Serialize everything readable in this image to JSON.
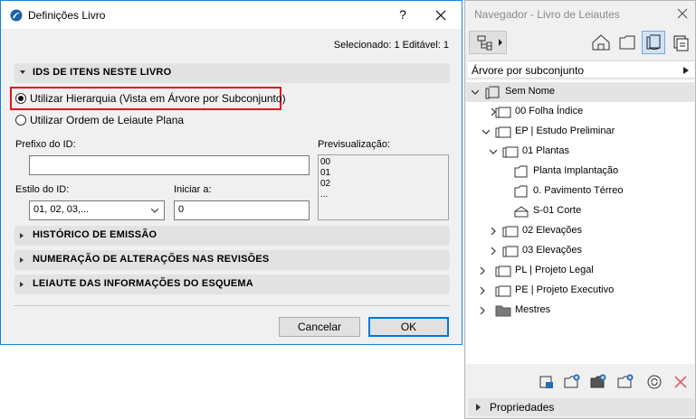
{
  "dialog": {
    "title": "Definições Livro",
    "help_label": "?",
    "selected_info": "Selecionado: 1 Editável: 1",
    "sections": {
      "ids": "IDS DE ITENS NESTE LIVRO",
      "history": "HISTÓRICO DE EMISSÃO",
      "numbering": "NUMERAÇÃO DE ALTERAÇÕES NAS REVISÕES",
      "layout_info": "LEIAUTE DAS INFORMAÇÕES DO ESQUEMA"
    },
    "radio_hierarchy": "Utilizar Hierarquia (Vista em Árvore por Subconjunto)",
    "radio_flat": "Utilizar Ordem de Leiaute Plana",
    "prefix_label": "Prefixo do ID:",
    "prefix_value": "",
    "preview_label": "Previsualização:",
    "preview_lines": [
      "00",
      "01",
      "02",
      "..."
    ],
    "style_label": "Estilo do ID:",
    "style_value": "01, 02, 03,...",
    "start_label": "Iniciar a:",
    "start_value": "0",
    "cancel_label": "Cancelar",
    "ok_label": "OK"
  },
  "navigator": {
    "title": "Navegador - Livro de Leiautes",
    "dropdown_label": "Árvore por subconjunto",
    "tree": [
      {
        "label": "Sem Nome"
      },
      {
        "label": "00 Folha Índice"
      },
      {
        "label": "EP | Estudo Preliminar"
      },
      {
        "label": "01 Plantas"
      },
      {
        "label": "Planta Implantação"
      },
      {
        "label": "0. Pavimento Térreo"
      },
      {
        "label": "S-01 Corte"
      },
      {
        "label": "02 Elevações"
      },
      {
        "label": "03 Elevações"
      },
      {
        "label": "PL | Projeto Legal"
      },
      {
        "label": "PE | Projeto Executivo"
      },
      {
        "label": "Mestres"
      }
    ],
    "properties_label": "Propriedades"
  }
}
